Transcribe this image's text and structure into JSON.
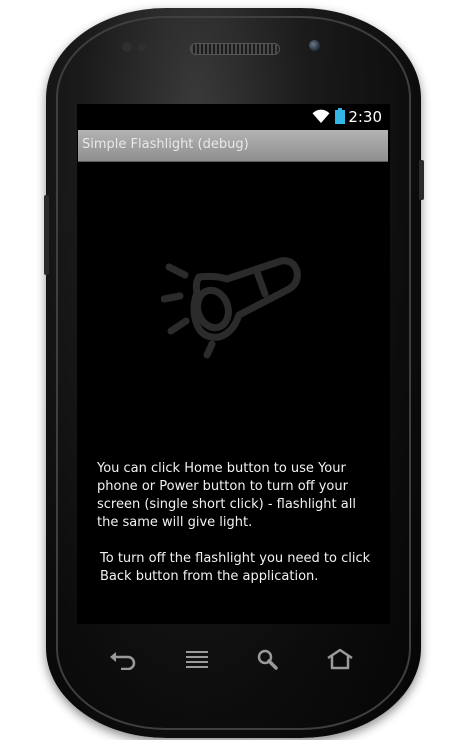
{
  "status_bar": {
    "time": "2:30",
    "wifi_icon": "wifi-icon",
    "battery_icon": "battery-icon",
    "battery_color": "#33b5e5"
  },
  "app": {
    "title": "Simple Flashlight (debug)",
    "illustration_icon": "flashlight-icon",
    "instructions": [
      "You can click Home button to use Your phone or Power button to turn off your screen (single short click) - flashlight all the same will give light.",
      "To turn off the flashlight you need to click Back button from the application."
    ]
  },
  "nav_keys": {
    "back": "back-icon",
    "menu": "menu-icon",
    "search": "search-icon",
    "home": "home-icon"
  }
}
